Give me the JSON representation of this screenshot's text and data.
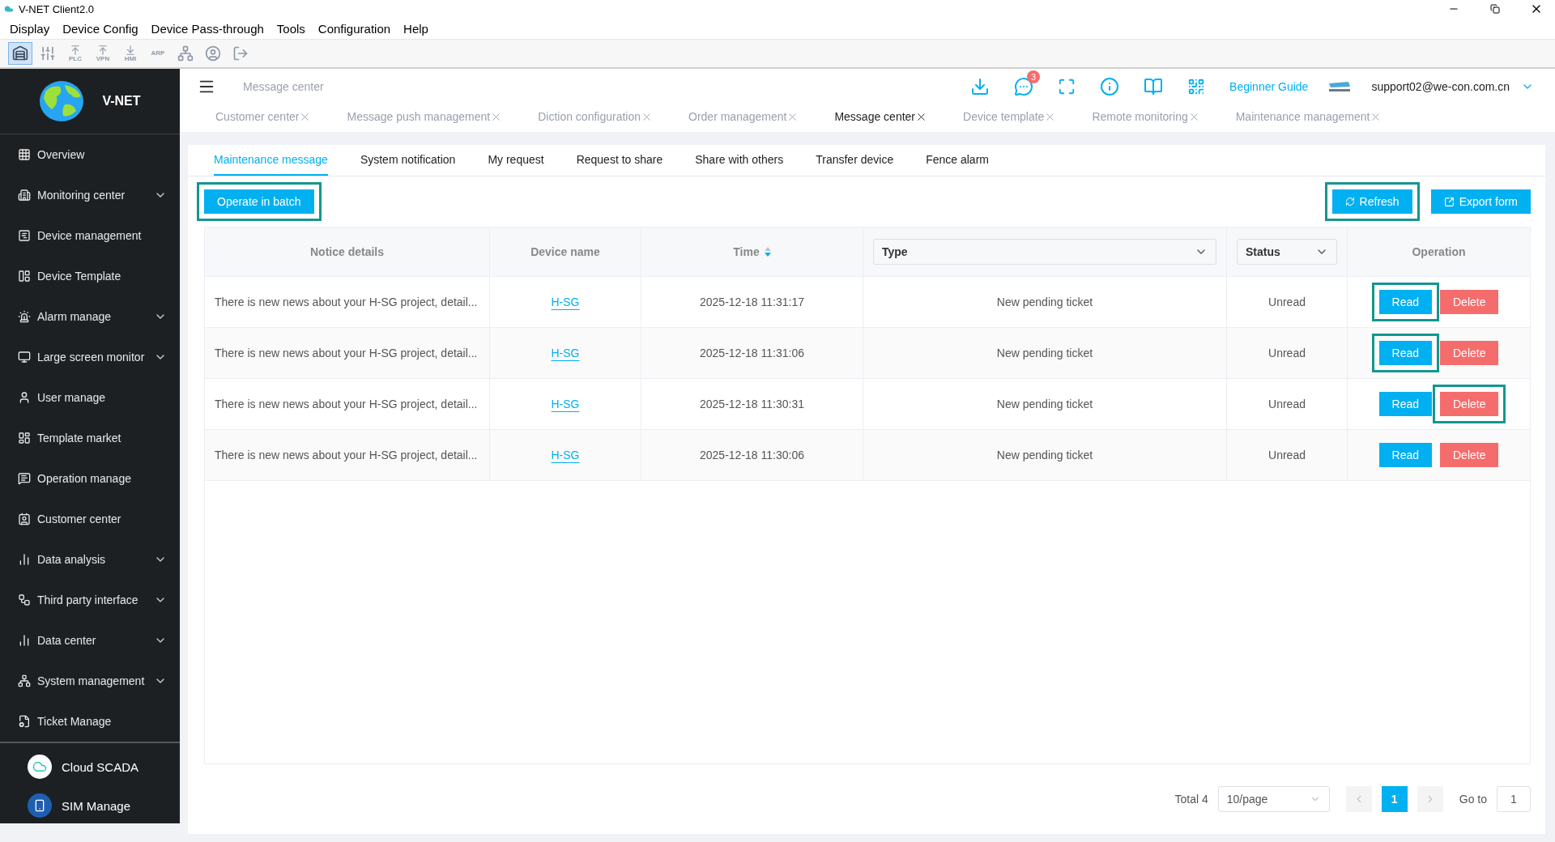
{
  "window": {
    "title": "V-NET Client2.0"
  },
  "menu": [
    "Display",
    "Device Config",
    "Device Pass-through",
    "Tools",
    "Configuration",
    "Help"
  ],
  "toolbar": [
    {
      "selected": true
    },
    {
      "selected": false
    },
    {
      "label": "PLC",
      "selected": false
    },
    {
      "label": "VPN",
      "selected": false
    },
    {
      "label": "HMI",
      "selected": false
    },
    {
      "label": "ARP",
      "selected": false
    },
    {
      "selected": false
    },
    {
      "selected": false
    },
    {
      "selected": false
    }
  ],
  "sidebar": {
    "brand": "V-NET",
    "items": [
      {
        "label": "Overview",
        "kind": "link"
      },
      {
        "label": "Monitoring center",
        "kind": "group"
      },
      {
        "label": "Device management",
        "kind": "link"
      },
      {
        "label": "Device Template",
        "kind": "link"
      },
      {
        "label": "Alarm manage",
        "kind": "group"
      },
      {
        "label": "Large screen monitor",
        "kind": "group"
      },
      {
        "label": "User manage",
        "kind": "link"
      },
      {
        "label": "Template market",
        "kind": "link"
      },
      {
        "label": "Operation manage",
        "kind": "link"
      },
      {
        "label": "Customer center",
        "kind": "link"
      },
      {
        "label": "Data analysis",
        "kind": "group"
      },
      {
        "label": "Third party interface",
        "kind": "group"
      },
      {
        "label": "Data center",
        "kind": "group"
      },
      {
        "label": "System management",
        "kind": "group"
      },
      {
        "label": "Ticket Manage",
        "kind": "link"
      }
    ],
    "apps": [
      "Cloud SCADA",
      "SIM Manage"
    ]
  },
  "header": {
    "breadcrumb": "Message center",
    "badge": "3",
    "guide": "Beginner Guide",
    "user": "support02@we-con.com.cn"
  },
  "open_tabs": [
    {
      "label": "Customer center",
      "selected": false
    },
    {
      "label": "Message push management",
      "selected": false
    },
    {
      "label": "Diction configuration",
      "selected": false
    },
    {
      "label": "Order management",
      "selected": false
    },
    {
      "label": "Message center",
      "selected": true
    },
    {
      "label": "Device template",
      "selected": false
    },
    {
      "label": "Remote monitoring",
      "selected": false
    },
    {
      "label": "Maintenance management",
      "selected": false
    }
  ],
  "tabs": [
    {
      "label": "Maintenance message",
      "selected": true
    },
    {
      "label": "System notification",
      "selected": false
    },
    {
      "label": "My request",
      "selected": false
    },
    {
      "label": "Request to share",
      "selected": false
    },
    {
      "label": "Share with others",
      "selected": false
    },
    {
      "label": "Transfer device",
      "selected": false
    },
    {
      "label": "Fence alarm",
      "selected": false
    }
  ],
  "actions": {
    "batch": {
      "label": "Operate in batch",
      "highlighted": true
    },
    "refresh": {
      "label": "Refresh",
      "highlighted": true
    },
    "export": {
      "label": "Export form",
      "highlighted": false
    }
  },
  "table": {
    "columns": [
      {
        "label": "Notice details",
        "kind": "text"
      },
      {
        "label": "Device name",
        "kind": "text"
      },
      {
        "label": "Time",
        "kind": "sort"
      },
      {
        "label": "Type",
        "kind": "select"
      },
      {
        "label": "Status",
        "kind": "select"
      },
      {
        "label": "Operation",
        "kind": "text"
      }
    ],
    "rows": [
      {
        "notice": "There is new news about your H-SG project, detail...",
        "device": "H-SG",
        "time": "2025-12-18 11:31:17",
        "type": "New pending ticket",
        "status": "Unread",
        "read": {
          "label": "Read",
          "highlighted": true
        },
        "delete": {
          "label": "Delete",
          "highlighted": false
        }
      },
      {
        "notice": "There is new news about your H-SG project, detail...",
        "device": "H-SG",
        "time": "2025-12-18 11:31:06",
        "type": "New pending ticket",
        "status": "Unread",
        "read": {
          "label": "Read",
          "highlighted": true
        },
        "delete": {
          "label": "Delete",
          "highlighted": false
        }
      },
      {
        "notice": "There is new news about your H-SG project, detail...",
        "device": "H-SG",
        "time": "2025-12-18 11:30:31",
        "type": "New pending ticket",
        "status": "Unread",
        "read": {
          "label": "Read",
          "highlighted": false
        },
        "delete": {
          "label": "Delete",
          "highlighted": true
        }
      },
      {
        "notice": "There is new news about your H-SG project, detail...",
        "device": "H-SG",
        "time": "2025-12-18 11:30:06",
        "type": "New pending ticket",
        "status": "Unread",
        "read": {
          "label": "Read",
          "highlighted": false
        },
        "delete": {
          "label": "Delete",
          "highlighted": false
        }
      }
    ]
  },
  "pagination": {
    "total": "Total 4",
    "page_size": "10/page",
    "pages": [
      {
        "label": "1",
        "selected": true
      }
    ],
    "goto_label": "Go to",
    "goto_value": "1"
  }
}
